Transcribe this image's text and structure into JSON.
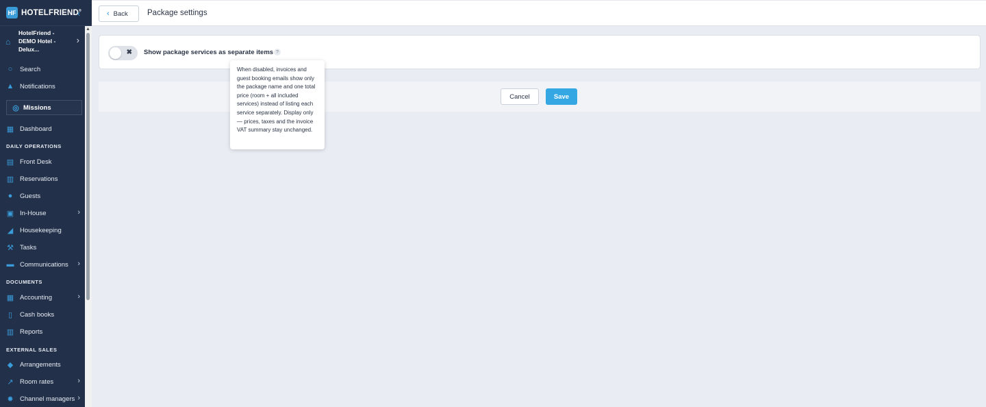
{
  "app": {
    "logo_text": "HOTELFRIEND",
    "logo_mark": "HF",
    "logo_reg": "®"
  },
  "hotel": {
    "name": "HotelFriend - DEMO Hotel - Delux..."
  },
  "sidebar": {
    "search": "Search",
    "notifications": "Notifications",
    "missions": "Missions",
    "dashboard": "Dashboard",
    "sections": {
      "daily": "DAILY OPERATIONS",
      "documents": "DOCUMENTS",
      "external": "EXTERNAL SALES"
    },
    "items": {
      "front_desk": "Front Desk",
      "reservations": "Reservations",
      "guests": "Guests",
      "in_house": "In-House",
      "housekeeping": "Housekeeping",
      "tasks": "Tasks",
      "communications": "Communications",
      "accounting": "Accounting",
      "cash_books": "Cash books",
      "reports": "Reports",
      "arrangements": "Arrangements",
      "room_rates": "Room rates",
      "channel_managers": "Channel managers"
    }
  },
  "topbar": {
    "back_label": "Back",
    "title": "Package settings"
  },
  "settings": {
    "toggle_label": "Show package services as separate items",
    "toggle_state": "off",
    "help_glyph": "?",
    "tooltip": "When disabled, invoices and guest booking emails show only the package name and one total price (room + all included services) instead of listing each service separately. Display only — prices, taxes and the invoice VAT summary stay unchanged."
  },
  "actions": {
    "cancel": "Cancel",
    "save": "Save"
  },
  "colors": {
    "sidebar_bg": "#22304a",
    "accent": "#35a8e3",
    "page_bg": "#e9ecf2"
  }
}
